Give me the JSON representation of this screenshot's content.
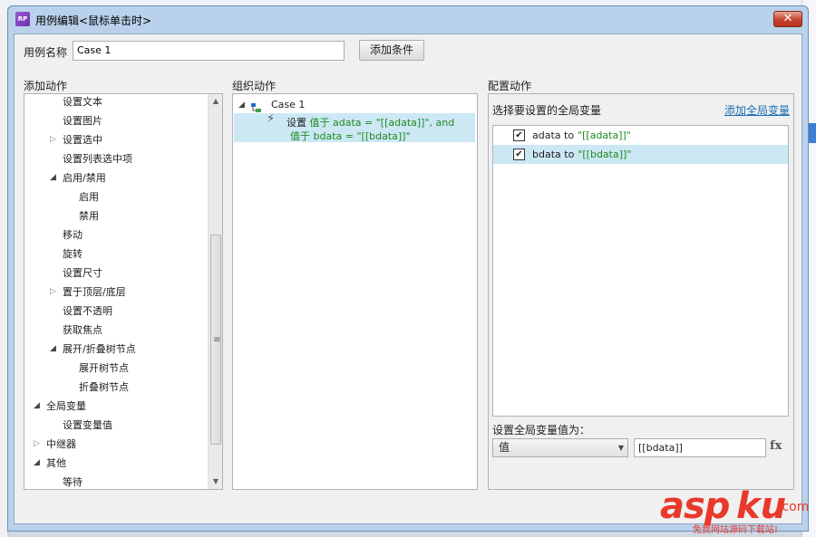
{
  "window": {
    "title": "用例编辑<鼠标单击时>",
    "icon_text": "RP",
    "close_label": "✕"
  },
  "case_name": {
    "label": "用例名称",
    "value": "Case 1",
    "add_condition_label": "添加条件"
  },
  "add_action": {
    "header": "添加动作",
    "items": [
      {
        "label": "设置文本",
        "expander": ""
      },
      {
        "label": "设置图片",
        "expander": ""
      },
      {
        "label": "设置选中",
        "expander": "closed"
      },
      {
        "label": "设置列表选中项",
        "expander": ""
      },
      {
        "label": "启用/禁用",
        "expander": "open"
      },
      {
        "label": "启用",
        "expander": ""
      },
      {
        "label": "禁用",
        "expander": ""
      },
      {
        "label": "移动",
        "expander": ""
      },
      {
        "label": "旋转",
        "expander": ""
      },
      {
        "label": "设置尺寸",
        "expander": ""
      },
      {
        "label": "置于顶层/底层",
        "expander": "closed"
      },
      {
        "label": "设置不透明",
        "expander": ""
      },
      {
        "label": "获取焦点",
        "expander": ""
      },
      {
        "label": "展开/折叠树节点",
        "expander": "open"
      },
      {
        "label": "展开树节点",
        "expander": ""
      },
      {
        "label": "折叠树节点",
        "expander": ""
      },
      {
        "label": "全局变量",
        "expander": "open"
      },
      {
        "label": "设置变量值",
        "expander": ""
      },
      {
        "label": "中继器",
        "expander": "closed"
      },
      {
        "label": "其他",
        "expander": "open"
      },
      {
        "label": "等待",
        "expander": ""
      }
    ]
  },
  "organize_action": {
    "header": "组织动作",
    "case_label": "Case 1",
    "action_prefix": "设置",
    "action_line1": "值于 adata = \"[[adata]]\", and",
    "action_line2": "值于 bdata = \"[[bdata]]\""
  },
  "configure_action": {
    "header": "配置动作",
    "select_label": "选择要设置的全局变量",
    "add_global_label": "添加全局变量",
    "variables": [
      {
        "name": "adata to",
        "value": "\"[[adata]]\"",
        "checked": true,
        "selected": false
      },
      {
        "name": "bdata to",
        "value": "\"[[bdata]]\"",
        "checked": true,
        "selected": true
      }
    ],
    "set_value_label": "设置全局变量值为：",
    "value_type": "值",
    "value_input": "[[bdata]]",
    "fx_label": "fx"
  },
  "watermark": {
    "brand_a": "asp",
    "brand_b": "ku",
    "suffix": ".com",
    "tagline": "免费网站源码下载站!"
  }
}
